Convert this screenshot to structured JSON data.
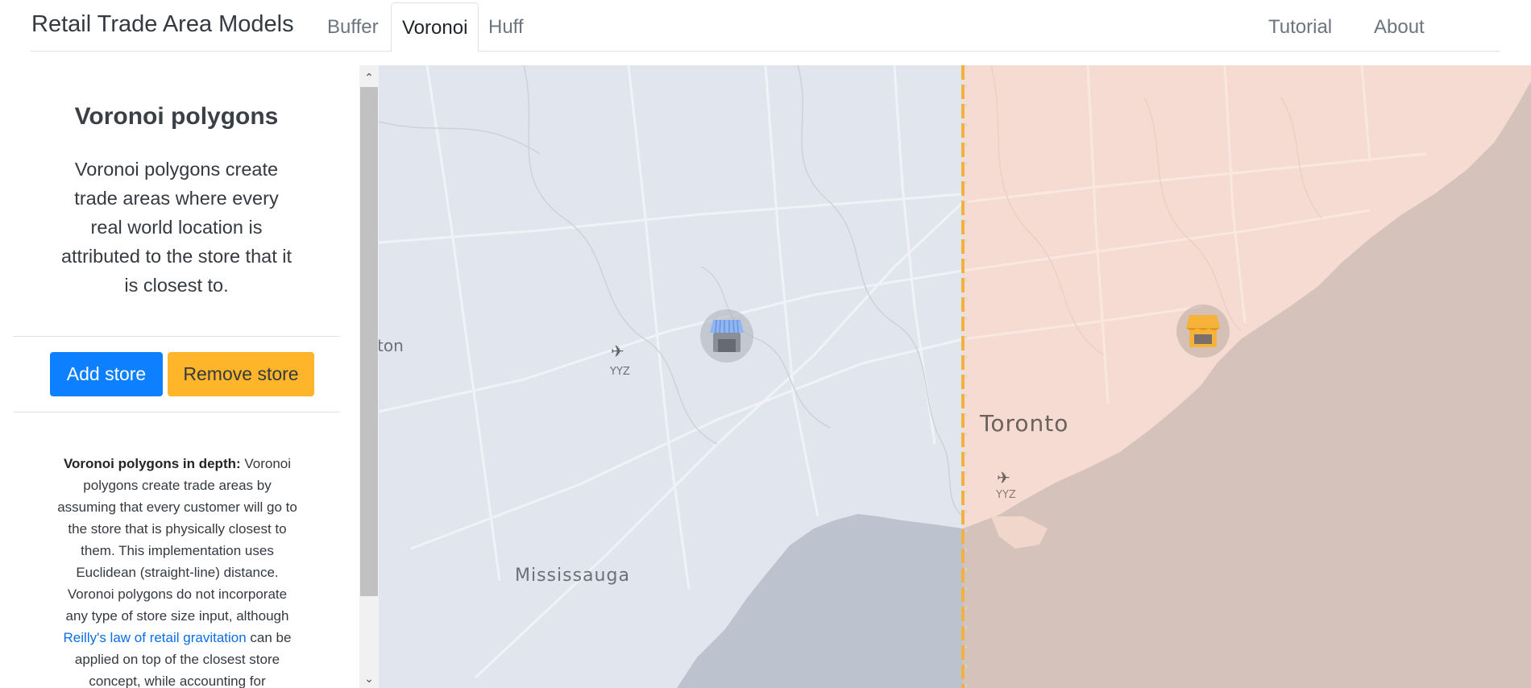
{
  "header": {
    "brand": "Retail Trade Area Models",
    "tabs": [
      "Buffer",
      "Voronoi",
      "Huff"
    ],
    "active_tab": "Voronoi",
    "right_links": [
      "Tutorial",
      "About"
    ]
  },
  "sidebar": {
    "title": "Voronoi polygons",
    "lead": "Voronoi polygons create trade areas where every real world location is attributed to the store that it is closest to.",
    "add_store_label": "Add store",
    "remove_store_label": "Remove store",
    "depth_heading": "Voronoi polygons in depth:",
    "depth_text_1": " Voronoi polygons create trade areas by assuming that every customer will go to the store that is physically closest to them. This implementation uses Euclidean (straight-line) distance. Voronoi polygons do not incorporate any type of store size input, although ",
    "depth_link": "Reilly's law of retail gravitation",
    "depth_text_2": " can be applied on top of the closest store concept, while accounting for"
  },
  "map": {
    "labels": {
      "mississauga": "Mississauga",
      "brampton": "ton",
      "toronto": "Toronto",
      "airport_1": "YYZ",
      "airport_2": "YYZ"
    },
    "colors": {
      "blue_zone": "#e1e6ee",
      "orange_zone": "#f5dbd1",
      "water_blue": "#bcc3cf",
      "water_orange": "#d5c3bb",
      "boundary": "#f3b23c",
      "store_blue": "#8fb5f2",
      "store_orange": "#f7b23a"
    },
    "icons": [
      "store-icon-blue",
      "store-icon-orange",
      "airport-icon"
    ]
  }
}
